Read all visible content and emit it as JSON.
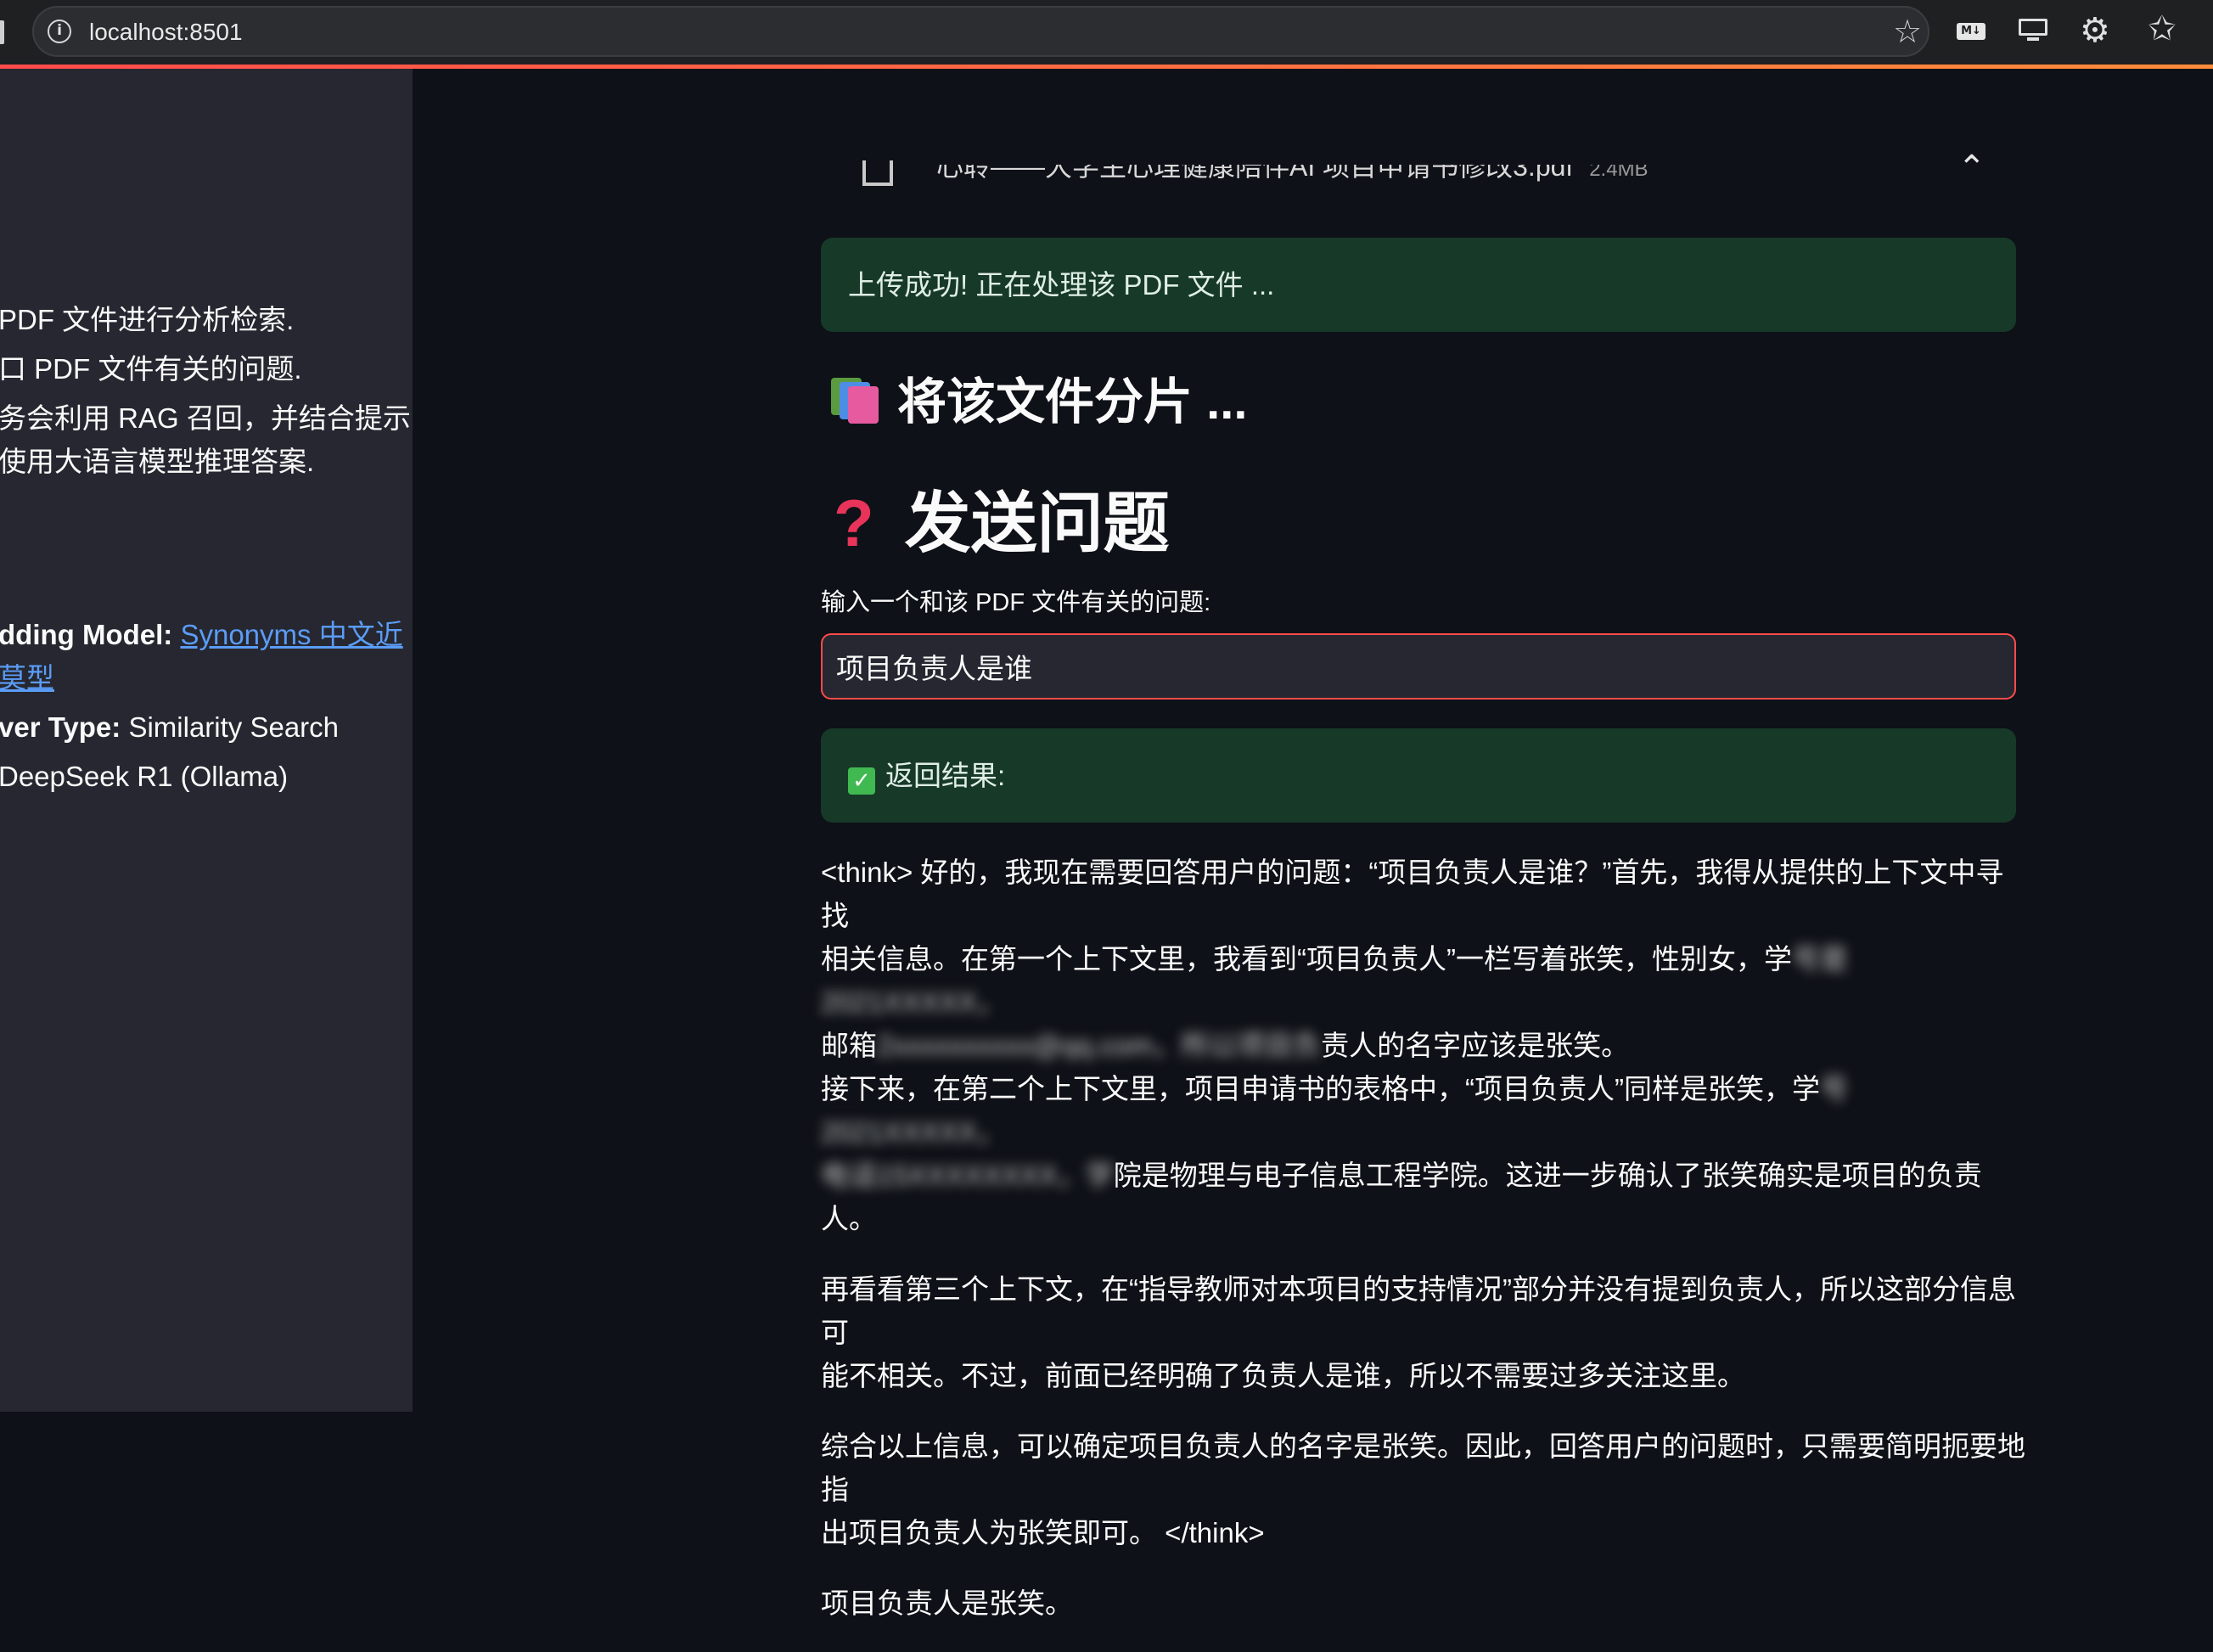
{
  "browser": {
    "url": "localhost:8501",
    "md_badge": "M↓"
  },
  "sidebar": {
    "desc_lines": [
      "PDF 文件进行分析检索.",
      "口 PDF 文件有关的问题.",
      "务会利用 RAG 召回，并结合提示",
      "使用大语言模型推理答案."
    ],
    "embedding_label": "dding Model:",
    "embedding_link_line1": "Synonyms 中文近",
    "embedding_link_line2": "莫型",
    "retriever_label": "ver Type:",
    "retriever_value": " Similarity Search",
    "llm_value": "DeepSeek R1 (Ollama)"
  },
  "main": {
    "uploaded_file": {
      "name": "心聆——大学生心理健康陪伴AI 项目申请书修改3.pdf",
      "size": "2.4MB"
    },
    "upload_success": "上传成功! 正在处理该 PDF 文件 ...",
    "split_heading": "将该文件分片 ...",
    "ask_heading": "发送问题",
    "input_label": "输入一个和该 PDF 文件有关的问题:",
    "input_value": "项目负责人是谁",
    "result_label": "返回结果:",
    "answer": {
      "p1_l1": "<think> 好的，我现在需要回答用户的问题：“项目负责人是谁？”首先，我得从提供的上下文中寻找",
      "p1_l2a": "相关信息。在第一个上下文里，我看到“项目负责人”一栏写着张笑，性别女，学",
      "p1_l2_blur": "号是2021XXXXX，",
      "p1_l3a": "邮箱",
      "p1_l3_blur": "2xxxxxxxxxx@qq.com，所以项目负",
      "p1_l3b": "责人的名字应该是张笑。",
      "p1_l4a": "接下来，在第二个上下文里，项目申请书的表格中，“项目负责人”同样是张笑，学",
      "p1_l4_blur": "号2021XXXXX，",
      "p1_l5_blur": "电话15XXXXXXXX，学",
      "p1_l5b": "院是物理与电子信息工程学院。这进一步确认了张笑确实是项目的负责人。",
      "p2_l1": "再看看第三个上下文，在“指导教师对本项目的支持情况”部分并没有提到负责人，所以这部分信息可",
      "p2_l2": "能不相关。不过，前面已经明确了负责人是谁，所以不需要过多关注这里。",
      "p3_l1": "综合以上信息，可以确定项目负责人的名字是张笑。因此，回答用户的问题时，只需要简明扼要地指",
      "p3_l2": "出项目负责人为张笑即可。 </think>",
      "final": "项目负责人是张笑。"
    }
  }
}
